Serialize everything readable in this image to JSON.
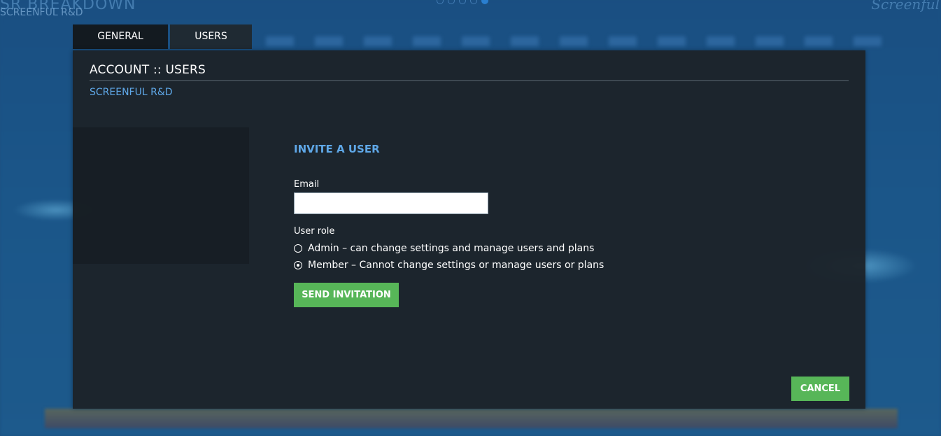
{
  "background": {
    "dashboard_title": "SR BREAKDOWN",
    "dashboard_subtitle": "SCREENFUL R&D",
    "logo_text": "Screenful"
  },
  "tabs": [
    {
      "label": "GENERAL",
      "active": true
    },
    {
      "label": "USERS",
      "active": false
    }
  ],
  "modal": {
    "title": "ACCOUNT :: USERS",
    "organization": "SCREENFUL R&D",
    "invite": {
      "heading": "INVITE A USER",
      "email_label": "Email",
      "email_value": "",
      "email_placeholder": "",
      "role_label": "User role",
      "roles": [
        {
          "label": "Admin – can change settings and manage users and plans",
          "selected": false
        },
        {
          "label": "Member – Cannot change settings or manage users or plans",
          "selected": true
        }
      ],
      "send_label": "SEND INVITATION"
    },
    "cancel_label": "CANCEL"
  },
  "colors": {
    "accent_blue": "#5fa8e8",
    "button_green": "#57b658",
    "modal_bg": "#1c232a",
    "page_bg": "#1d4f80"
  }
}
